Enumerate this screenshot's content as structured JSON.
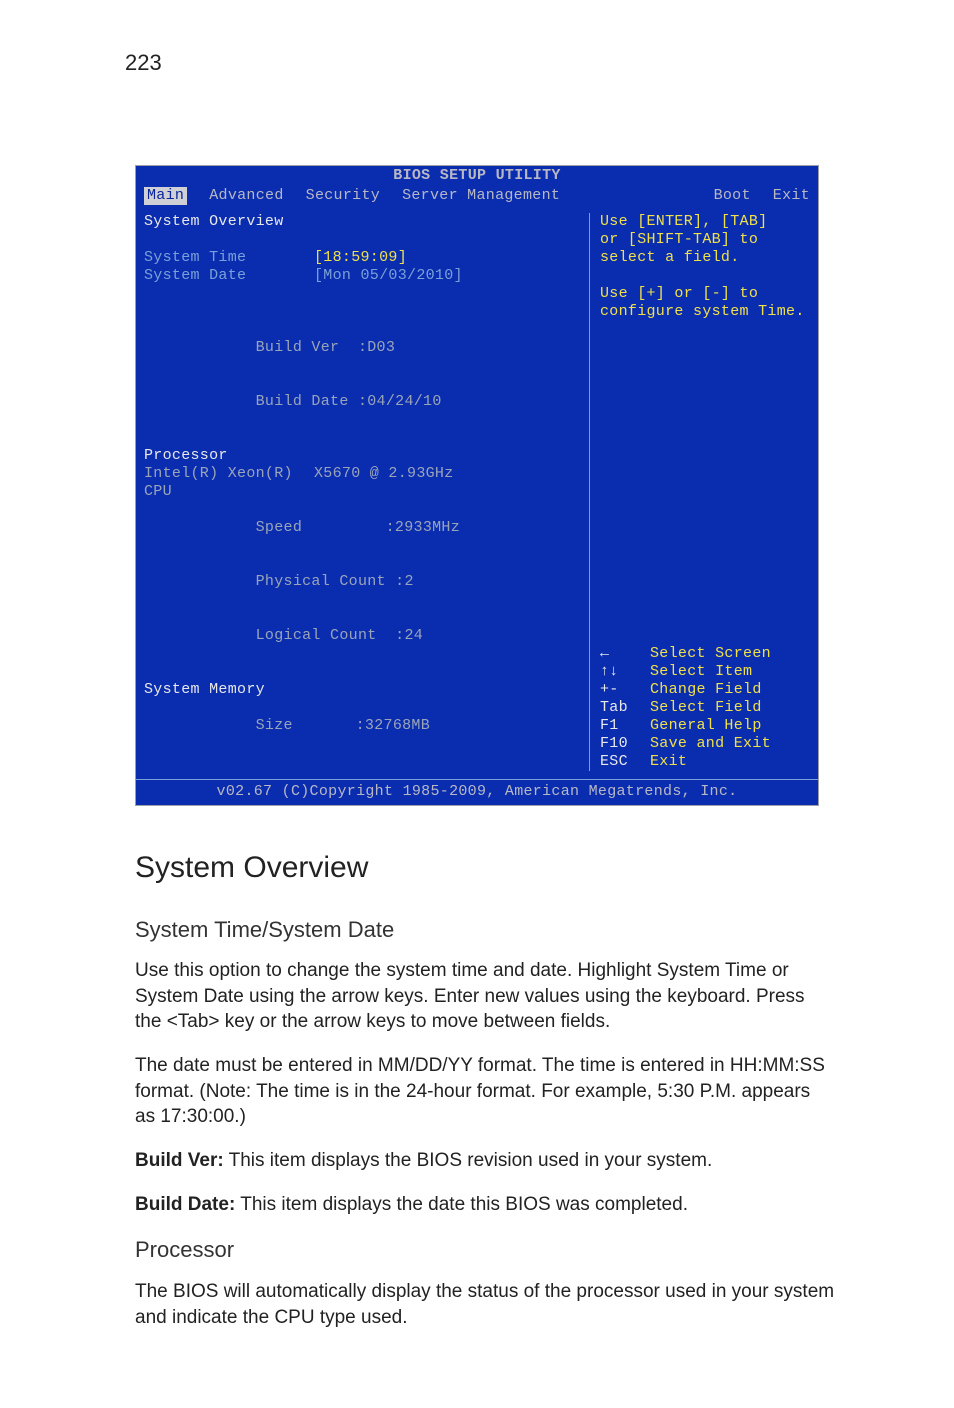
{
  "page_number": "223",
  "bios": {
    "title": "BIOS SETUP UTILITY",
    "tabs": {
      "main": "Main",
      "advanced": "Advanced",
      "security": "Security",
      "server_mgmt": "Server Management",
      "boot": "Boot",
      "exit": "Exit"
    },
    "overview_heading": "System Overview",
    "system_time_label": "System Time",
    "system_time_value": "[18:59:09]",
    "system_date_label": "System Date",
    "system_date_value": "[Mon 05/03/2010]",
    "build_ver_label": "Build Ver  :",
    "build_ver_value": "D03",
    "build_date_label": "Build Date :",
    "build_date_value": "04/24/10",
    "processor_heading": "Processor",
    "cpu_name_left": "Intel(R) Xeon(R) CPU",
    "cpu_name_right": "X5670  @ 2.93GHz",
    "speed_label": "Speed",
    "speed_value": ":2933MHz",
    "phys_label": "Physical Count :",
    "phys_value": "2",
    "log_label": "Logical Count  :",
    "log_value": "24",
    "mem_heading": "System Memory",
    "mem_size_label": "Size",
    "mem_size_value": ":32768MB",
    "help": {
      "line1": "Use [ENTER], [TAB]",
      "line2": "or [SHIFT-TAB] to",
      "line3": "select a field.",
      "line4": "Use [+] or [-] to",
      "line5": "configure system Time."
    },
    "keys": {
      "arrow_lr": "←",
      "arrow_lr_d": "Select Screen",
      "arrow_ud": "↑↓",
      "arrow_ud_d": "Select Item",
      "plusminus": "+-",
      "plusminus_d": "Change Field",
      "tab": "Tab",
      "tab_d": "Select Field",
      "f1": "F1",
      "f1_d": "General Help",
      "f10": "F10",
      "f10_d": "Save and Exit",
      "esc": "ESC",
      "esc_d": "Exit"
    },
    "footer": "v02.67 (C)Copyright 1985-2009, American Megatrends, Inc."
  },
  "doc": {
    "h1": "System Overview",
    "h2a": "System Time/System Date",
    "p1": "Use this option to change the system time and date. Highlight System Time or System Date using the arrow keys. Enter new values using the keyboard. Press the <Tab> key or the arrow keys to move between fields.",
    "p2": "The date must be entered in MM/DD/YY format. The time is entered in HH:MM:SS format. (Note: The time is in the 24-hour format. For example, 5:30 P.M. appears as 17:30:00.)",
    "p3_bold": "Build Ver:",
    "p3_rest": " This item displays the BIOS revision used in your system.",
    "p4_bold": "Build Date:",
    "p4_rest": " This item displays the date this BIOS was completed.",
    "h2b": "Processor",
    "p5": "The BIOS will automatically display the status of the processor used in your system and indicate the CPU type used."
  }
}
